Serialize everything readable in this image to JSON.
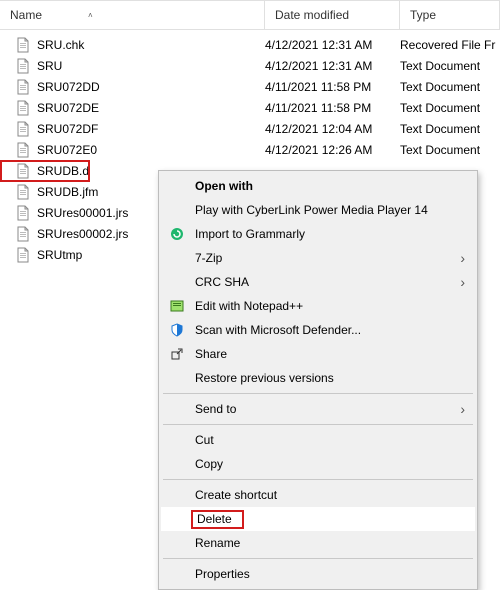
{
  "columns": {
    "name": "Name",
    "date": "Date modified",
    "type": "Type"
  },
  "files": [
    {
      "name": "SRU.chk",
      "date": "4/12/2021 12:31 AM",
      "type": "Recovered File Fr"
    },
    {
      "name": "SRU",
      "date": "4/12/2021 12:31 AM",
      "type": "Text Document"
    },
    {
      "name": "SRU072DD",
      "date": "4/11/2021 11:58 PM",
      "type": "Text Document"
    },
    {
      "name": "SRU072DE",
      "date": "4/11/2021 11:58 PM",
      "type": "Text Document"
    },
    {
      "name": "SRU072DF",
      "date": "4/12/2021 12:04 AM",
      "type": "Text Document"
    },
    {
      "name": "SRU072E0",
      "date": "4/12/2021 12:26 AM",
      "type": "Text Document"
    },
    {
      "name": "SRUDB.dat",
      "date": "",
      "type": ""
    },
    {
      "name": "SRUDB.jfm",
      "date": "",
      "type": ""
    },
    {
      "name": "SRUres00001.jrs",
      "date": "",
      "type": ""
    },
    {
      "name": "SRUres00002.jrs",
      "date": "",
      "type": ""
    },
    {
      "name": "SRUtmp",
      "date": "",
      "type": ""
    }
  ],
  "selected_index": 6,
  "context_menu": {
    "open_with": "Open with",
    "play_with": "Play with CyberLink Power Media Player 14",
    "grammarly": "Import to Grammarly",
    "seven_zip": "7-Zip",
    "crc_sha": "CRC SHA",
    "notepadpp": "Edit with Notepad++",
    "defender": "Scan with Microsoft Defender...",
    "share": "Share",
    "restore": "Restore previous versions",
    "send_to": "Send to",
    "cut": "Cut",
    "copy": "Copy",
    "shortcut": "Create shortcut",
    "delete": "Delete",
    "rename": "Rename",
    "properties": "Properties"
  }
}
